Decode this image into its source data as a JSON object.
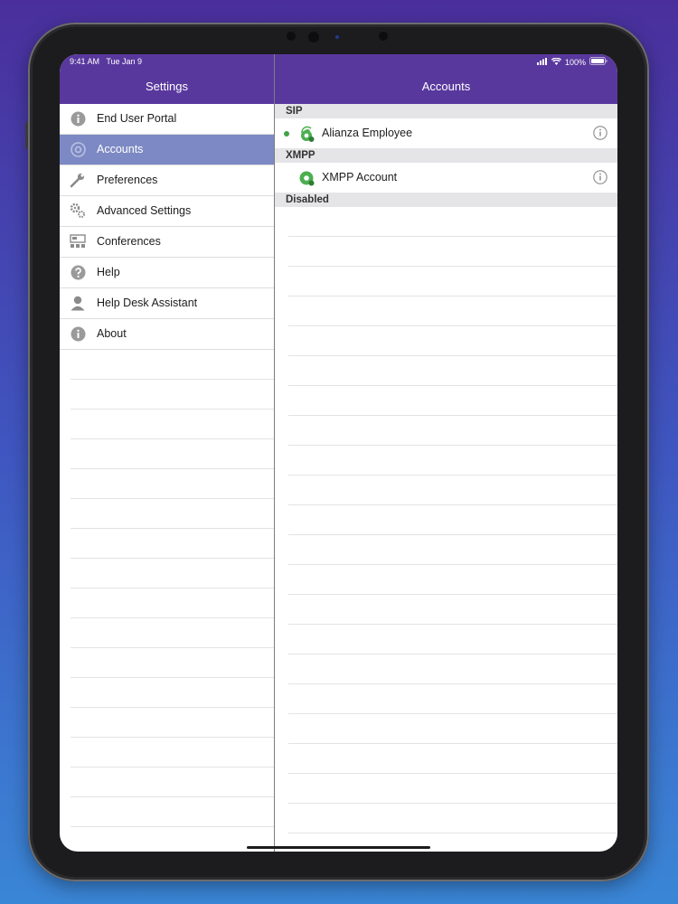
{
  "status_bar": {
    "time": "9:41 AM",
    "date": "Tue Jan 9",
    "battery": "100%"
  },
  "left_panel": {
    "title": "Settings",
    "items": [
      {
        "label": "End User Portal",
        "icon": "info-icon",
        "selected": false
      },
      {
        "label": "Accounts",
        "icon": "at-sign-icon",
        "selected": true
      },
      {
        "label": "Preferences",
        "icon": "wrench-icon",
        "selected": false
      },
      {
        "label": "Advanced Settings",
        "icon": "gears-icon",
        "selected": false
      },
      {
        "label": "Conferences",
        "icon": "conference-icon",
        "selected": false
      },
      {
        "label": "Help",
        "icon": "question-icon",
        "selected": false
      },
      {
        "label": "Help Desk Assistant",
        "icon": "person-icon",
        "selected": false
      },
      {
        "label": "About",
        "icon": "info-icon",
        "selected": false
      }
    ]
  },
  "right_panel": {
    "title": "Accounts",
    "sections": [
      {
        "header": "SIP",
        "accounts": [
          {
            "label": "Alianza Employee",
            "active": true,
            "icon": "sip-account-icon"
          }
        ]
      },
      {
        "header": "XMPP",
        "accounts": [
          {
            "label": "XMPP Account",
            "active": false,
            "icon": "xmpp-account-icon"
          }
        ]
      },
      {
        "header": "Disabled",
        "accounts": []
      }
    ]
  },
  "colors": {
    "nav_bar": "#59389e",
    "selected_row": "#7d89c4",
    "active_dot": "#43a047",
    "account_icon": "#4caf50"
  }
}
